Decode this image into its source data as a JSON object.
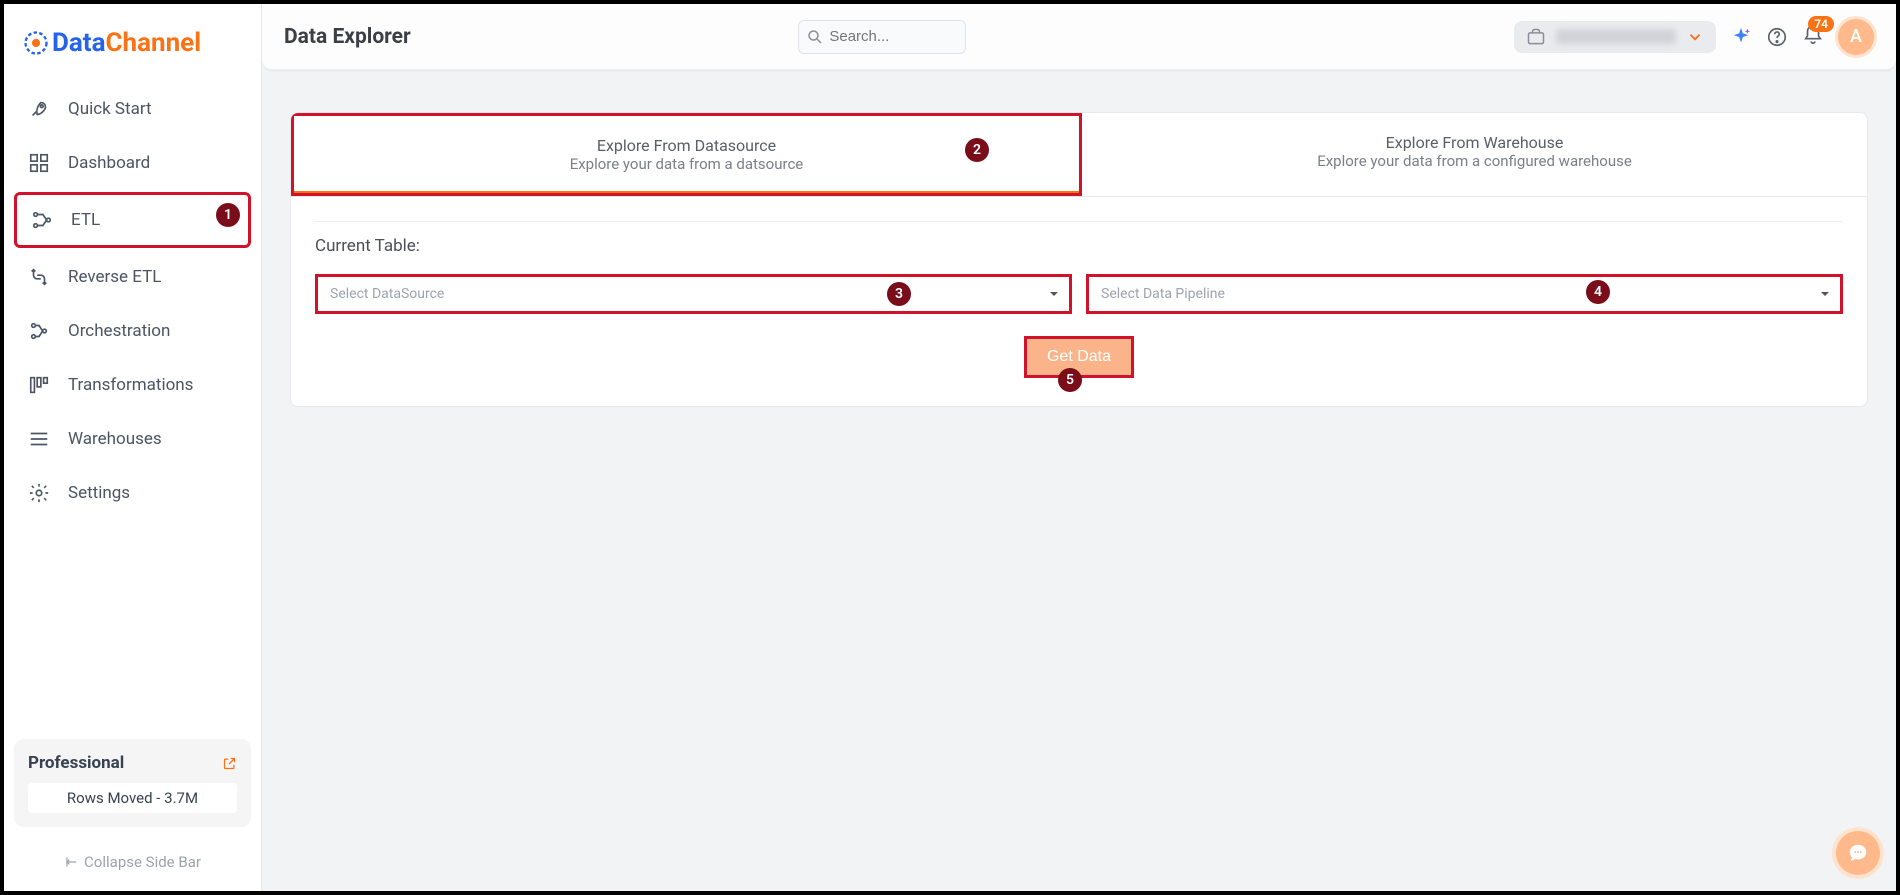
{
  "logo": {
    "text1": "Data",
    "text2": "Channel"
  },
  "sidebar": {
    "items": [
      {
        "label": "Quick Start"
      },
      {
        "label": "Dashboard"
      },
      {
        "label": "ETL"
      },
      {
        "label": "Reverse ETL"
      },
      {
        "label": "Orchestration"
      },
      {
        "label": "Transformations"
      },
      {
        "label": "Warehouses"
      },
      {
        "label": "Settings"
      }
    ],
    "plan": "Professional",
    "rows_moved": "Rows Moved - 3.7M",
    "collapse": "Collapse Side Bar"
  },
  "header": {
    "title": "Data Explorer",
    "search_placeholder": "Search...",
    "badge": "74",
    "avatar": "A"
  },
  "tabs": {
    "t1_title": "Explore From Datasource",
    "t1_sub": "Explore your data from a datsource",
    "t2_title": "Explore From Warehouse",
    "t2_sub": "Explore your data from a configured warehouse"
  },
  "form": {
    "current_table_label": "Current Table:",
    "select_datasource": "Select DataSource",
    "select_pipeline": "Select Data Pipeline",
    "get_data": "Get Data"
  },
  "callouts": {
    "c1": "1",
    "c2": "2",
    "c3": "3",
    "c4": "4",
    "c5": "5"
  }
}
